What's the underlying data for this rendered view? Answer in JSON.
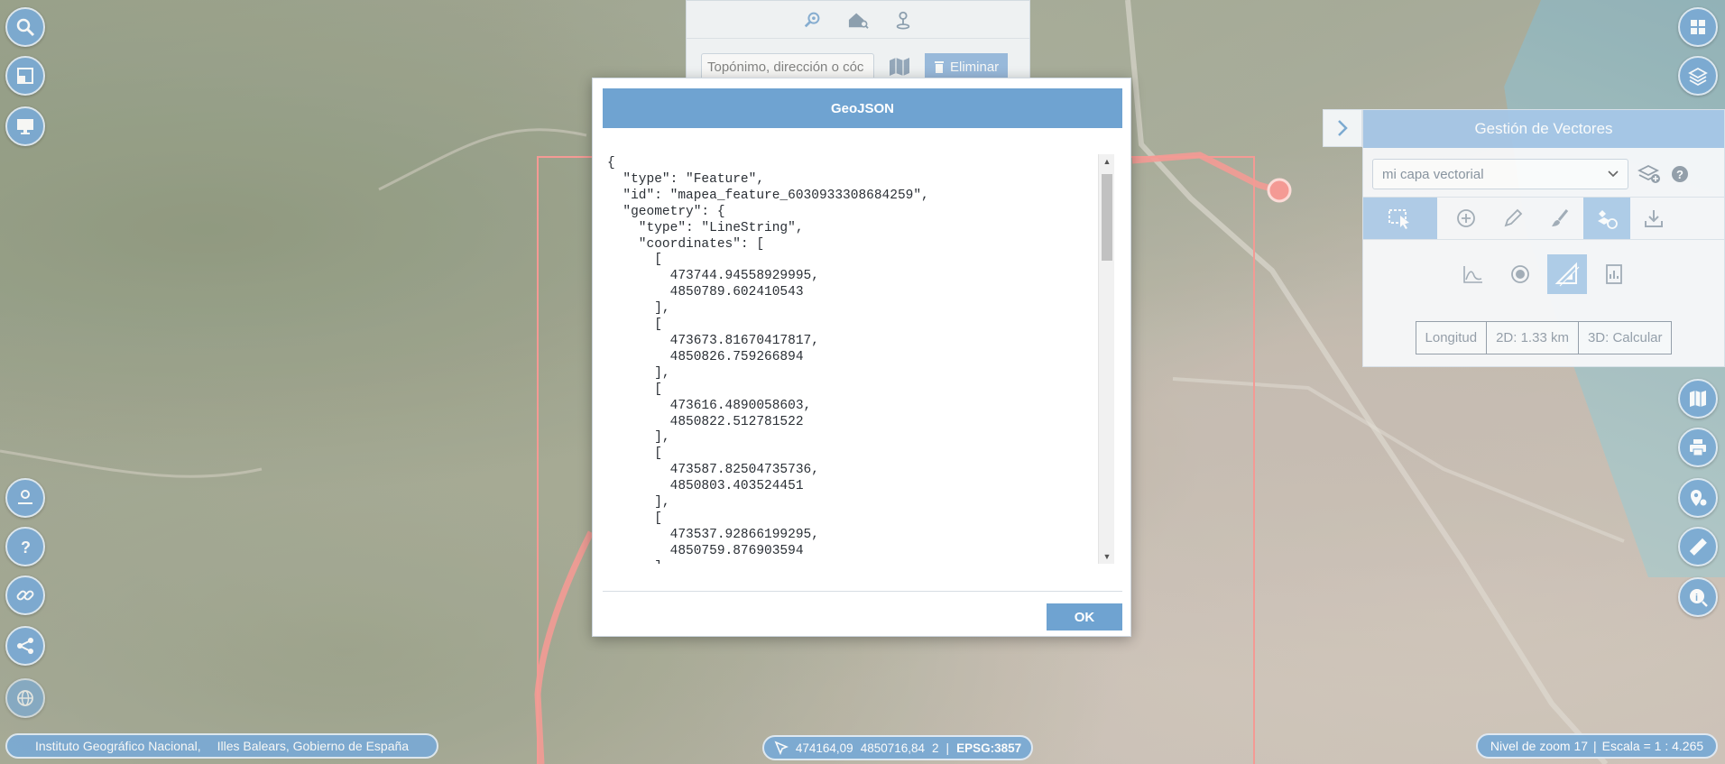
{
  "search": {
    "placeholder": "Topónimo, dirección o cóc",
    "delete_label": "Eliminar",
    "tab_icons": [
      "search-location-icon",
      "house-search-icon",
      "person-pin-icon"
    ]
  },
  "vector_panel": {
    "title": "Gestión de Vectores",
    "layer_select": "mi capa vectorial",
    "measure": {
      "label": "Longitud",
      "d2": "2D: 1.33 km",
      "d3": "3D: Calcular"
    }
  },
  "modal": {
    "title": "GeoJSON",
    "ok_label": "OK",
    "lines": [
      "{",
      "  \"type\": \"Feature\",",
      "  \"id\": \"mapea_feature_6030933308684259\",",
      "  \"geometry\": {",
      "    \"type\": \"LineString\",",
      "    \"coordinates\": [",
      "      [",
      "        473744.94558929995,",
      "        4850789.602410543",
      "      ],",
      "      [",
      "        473673.81670417817,",
      "        4850826.759266894",
      "      ],",
      "      [",
      "        473616.4890058603,",
      "        4850822.512781522",
      "      ],",
      "      [",
      "        473587.82504735736,",
      "        4850803.403524451",
      "      ],",
      "      [",
      "        473537.92866199295,",
      "        4850759.876903594",
      "      ],"
    ]
  },
  "footer": {
    "attribution_1": "Instituto Geográfico Nacional,",
    "attribution_2": "Illes Balears, Gobierno de España",
    "coord_x": "474164,09",
    "coord_y": "4850716,84",
    "coord_z": "2",
    "epsg": "EPSG:3857",
    "zoom_level": "Nivel de zoom 17",
    "scale": "Escala = 1 : 4.265"
  },
  "colors": {
    "accent": "#6fa3d1",
    "route": "#f17b72"
  }
}
